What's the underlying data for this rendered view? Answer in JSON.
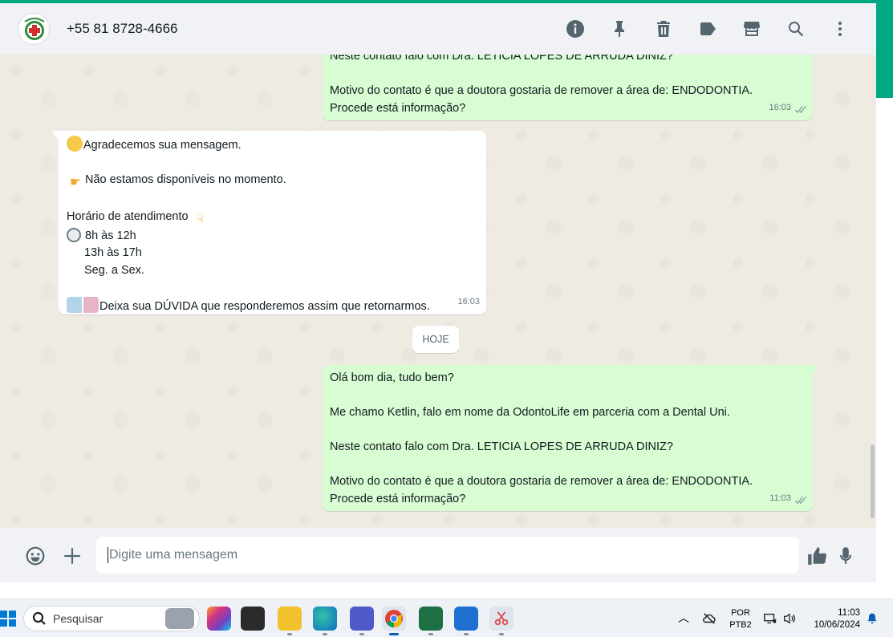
{
  "header": {
    "contact_name": "+55 81 8728-4666",
    "icons": [
      "info-icon",
      "pin-icon",
      "delete-icon",
      "label-icon",
      "store-icon",
      "search-icon",
      "menu-icon"
    ]
  },
  "messages": [
    {
      "direction": "out",
      "lines": [
        "Neste contato falo com Dra. LETICIA LOPES DE ARRUDA DINIZ?",
        "",
        "Motivo do contato é que a doutora gostaria de remover a área de: ENDODONTIA.",
        "Procede está informação?"
      ],
      "time": "16:03"
    },
    {
      "direction": "in",
      "lines": [
        "Agradecemos sua mensagem.",
        "",
        "Não estamos disponíveis no momento.",
        "",
        "Horário de atendimento",
        " 8h às 12h",
        "13h às 17h",
        "Seg. a Sex.",
        "",
        "Deixa sua DÚVIDA que responderemos assim que retornarmos."
      ],
      "time": "16:03"
    },
    {
      "direction": "out",
      "lines": [
        "Olá bom dia, tudo bem?",
        "",
        "Me chamo Ketlin, falo em nome da OdontoLife em parceria com a Dental Uni.",
        "",
        "Neste contato falo com Dra. LETICIA LOPES DE ARRUDA DINIZ?",
        "",
        "Motivo do contato é que a doutora gostaria de remover a área de: ENDODONTIA.",
        "Procede está informação?"
      ],
      "time": "11:03"
    }
  ],
  "date_divider": "HOJE",
  "composer": {
    "placeholder": "Digite uma mensagem"
  },
  "taskbar": {
    "search_placeholder": "Pesquisar",
    "language_top": "POR",
    "language_bottom": "PTB2",
    "time": "11:03",
    "date": "10/06/2024"
  },
  "colors": {
    "accent": "#00a884",
    "outgoing_bubble": "#d9fdd3",
    "incoming_bubble": "#ffffff",
    "chat_background": "#efeae2",
    "header_background": "#f0f2f5"
  }
}
